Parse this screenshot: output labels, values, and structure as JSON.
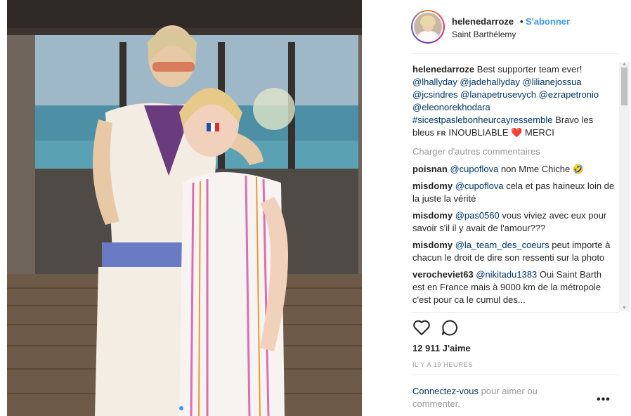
{
  "post": {
    "username": "helenedarroze",
    "dot": "•",
    "follow_label": "S'abonner",
    "location": "Saint Barthélemy"
  },
  "caption": {
    "author": "helenedarroze",
    "text_1": "Best supporter team ever!",
    "tags": [
      "@lhallyday",
      "@jadehallyday",
      "@lilianejossua",
      "@jcsindres",
      "@lanapetrusevych",
      "@ezrapetronio",
      "@eleonorekhodara",
      "#sicestpaslebonheurcayressemble"
    ],
    "text_2": "Bravo les bleus",
    "flag": "FR",
    "text_3": "INOUBLIABLE",
    "heart": "❤️",
    "text_4": "MERCI"
  },
  "load_more_label": "Charger d'autres commentaires",
  "comments": [
    {
      "author": "poisnan",
      "mention": "@cupoflova",
      "text": "non Mme Chiche",
      "emoji": "🤣"
    },
    {
      "author": "misdomy",
      "mention": "@cupoflova",
      "text": "cela et pas haineux loin de la juste la vérité"
    },
    {
      "author": "misdomy",
      "mention": "@pas0560",
      "text": "vous viviez avec eux pour savoir s'il il y avait de l'amour???"
    },
    {
      "author": "misdomy",
      "mention": "@la_team_des_coeurs",
      "text": "peut importe à chacun le droit de dire son ressenti sur la photo"
    },
    {
      "author": "verocheviet63",
      "mention": "@nikitadu1383",
      "text": "Oui Saint Barth est en France mais à 9000 km de la métropole c'est pour ca le cumul des..."
    }
  ],
  "likes": "12 911 J'aime",
  "timestamp": "IL Y A 19 HEURES",
  "login_prompt": {
    "link": "Connectez-vous",
    "text": "pour aimer ou commenter."
  },
  "more_options": "•••",
  "icons": {
    "like": "heart-outline-icon",
    "comment": "comment-bubble-icon",
    "options": "more-options-icon"
  },
  "colors": {
    "link_blue": "#3897f0",
    "hashtag": "#003569",
    "muted": "#999999"
  }
}
